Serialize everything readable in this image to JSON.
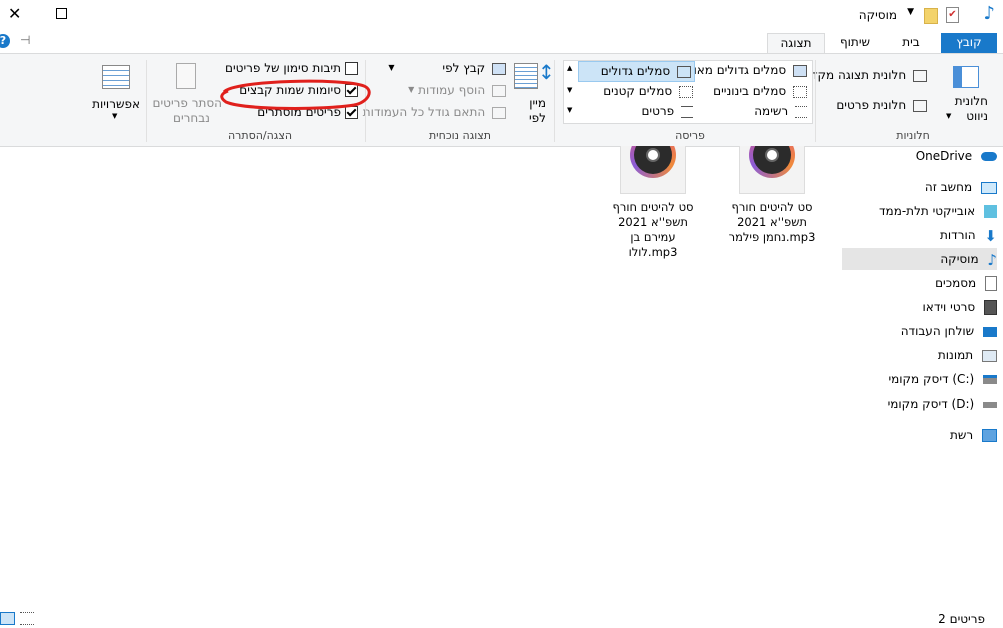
{
  "window": {
    "title": "מוסיקה",
    "close_glyph": "✕",
    "max_glyph": "☐",
    "help_glyph": "?",
    "pin_glyph": "⊣"
  },
  "ribbon_tabs": [
    "קובץ",
    "בית",
    "שיתוף",
    "תצוגה"
  ],
  "ribbon": {
    "panes": {
      "title": "חלוניות",
      "nav_pane": "חלונית ניווט",
      "nav_pane_line1": "חלונית",
      "nav_pane_line2": "ניווט",
      "preview_pane": "חלונית תצוגה מקדימה",
      "details_pane": "חלונית פרטים"
    },
    "layout": {
      "title": "פריסה",
      "items": [
        "סמלים גדולים מאוד",
        "סמלים גדולים",
        "סמלים בינוניים",
        "סמלים קטנים",
        "רשימה",
        "פרטים"
      ]
    },
    "current_view": {
      "title": "תצוגה נוכחית",
      "sort_by": "מיין לפי",
      "sort_by_line1": "מיין",
      "sort_by_line2": "לפי",
      "group_by": "קבץ לפי",
      "add_columns": "הוסף עמודות",
      "fit_columns": "התאם גודל כל העמודות"
    },
    "show_hide": {
      "title": "הצגה/הסתרה",
      "checkbox_items": "תיבות סימון של פריטים",
      "file_extensions": "סיומות שמות קבצים",
      "hidden_items": "פריטים מוסתרים",
      "hide_selected": "הסתר פריטים נבחרים",
      "hide_selected_line1": "הסתר פריטים",
      "hide_selected_line2": "נבחרים",
      "options": "אפשרויות"
    },
    "checked": {
      "checkbox_items": false,
      "file_extensions": true,
      "hidden_items": true
    }
  },
  "nav_tree": [
    {
      "label": "OneDrive",
      "icon": "cloud-icon"
    },
    {
      "label": "מחשב זה",
      "icon": "computer-icon"
    },
    {
      "label": "אובייקטי תלת-ממד",
      "icon": "cube-icon"
    },
    {
      "label": "הורדות",
      "icon": "download-icon"
    },
    {
      "label": "מוסיקה",
      "icon": "music-icon",
      "selected": true
    },
    {
      "label": "מסמכים",
      "icon": "document-icon"
    },
    {
      "label": "סרטי וידאו",
      "icon": "video-icon"
    },
    {
      "label": "שולחן העבודה",
      "icon": "desktop-icon"
    },
    {
      "label": "תמונות",
      "icon": "pictures-icon"
    },
    {
      "label": "דיסק מקומי (C:)",
      "icon": "drive-icon"
    },
    {
      "label": "דיסק מקומי (D:)",
      "icon": "drive-icon"
    },
    {
      "label": "רשת",
      "icon": "network-icon"
    }
  ],
  "files": [
    {
      "line1": "סט להיטים חורף",
      "line2": "תשפ''א 2021",
      "line3": "נחמן פילמר.mp3",
      "line4": ""
    },
    {
      "line1": "סט להיטים חורף",
      "line2": "תשפ''א 2021",
      "line3": "עמירם בן",
      "line4": "לולו.mp3"
    }
  ],
  "status": {
    "count": "2 פריטים"
  },
  "colors": {
    "accent": "#1979ca",
    "annotation": "#e0201c",
    "selected_bg": "#e5e5e5"
  }
}
